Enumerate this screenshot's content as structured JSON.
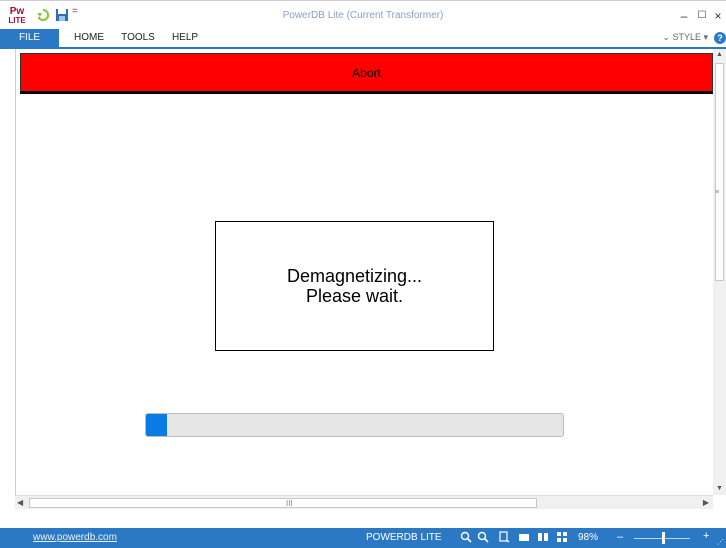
{
  "window": {
    "title": "PowerDB Lite (Current Transformer)",
    "app_icon_text_1": "Pw",
    "app_icon_text_2": "LITE",
    "minimize": "–",
    "maximize": "☐",
    "close": "×"
  },
  "qat": {
    "refresh_icon": "refresh-icon",
    "save_icon": "save-icon",
    "more": "="
  },
  "menu": {
    "items": [
      "FILE",
      "HOME",
      "TOOLS",
      "HELP"
    ],
    "style_label": "STYLE",
    "style_arrow_left": "⌄",
    "style_arrow_right": "▾",
    "help_glyph": "?"
  },
  "content": {
    "abort_label": "Abort",
    "message_line1": "Demagnetizing...",
    "message_line2": "Please wait.",
    "progress_fraction": 0.05,
    "progress_color": "#0a7be4",
    "abort_color": "#ff0000"
  },
  "scrollbars": {
    "up": "▲",
    "down": "▼",
    "left": "◀",
    "right": "▶",
    "vgrip": "≡",
    "hgrip": "III"
  },
  "status": {
    "link": "www.powerdb.com",
    "app_name": "POWERDB LITE",
    "zoom_level": "98%",
    "zoom_minus": "–",
    "zoom_plus": "+",
    "icons": [
      "zoom-in-icon",
      "zoom-out-icon",
      "page-icon",
      "one-page-icon",
      "two-page-icon",
      "multi-page-icon"
    ],
    "accent": "#2b79c4"
  }
}
